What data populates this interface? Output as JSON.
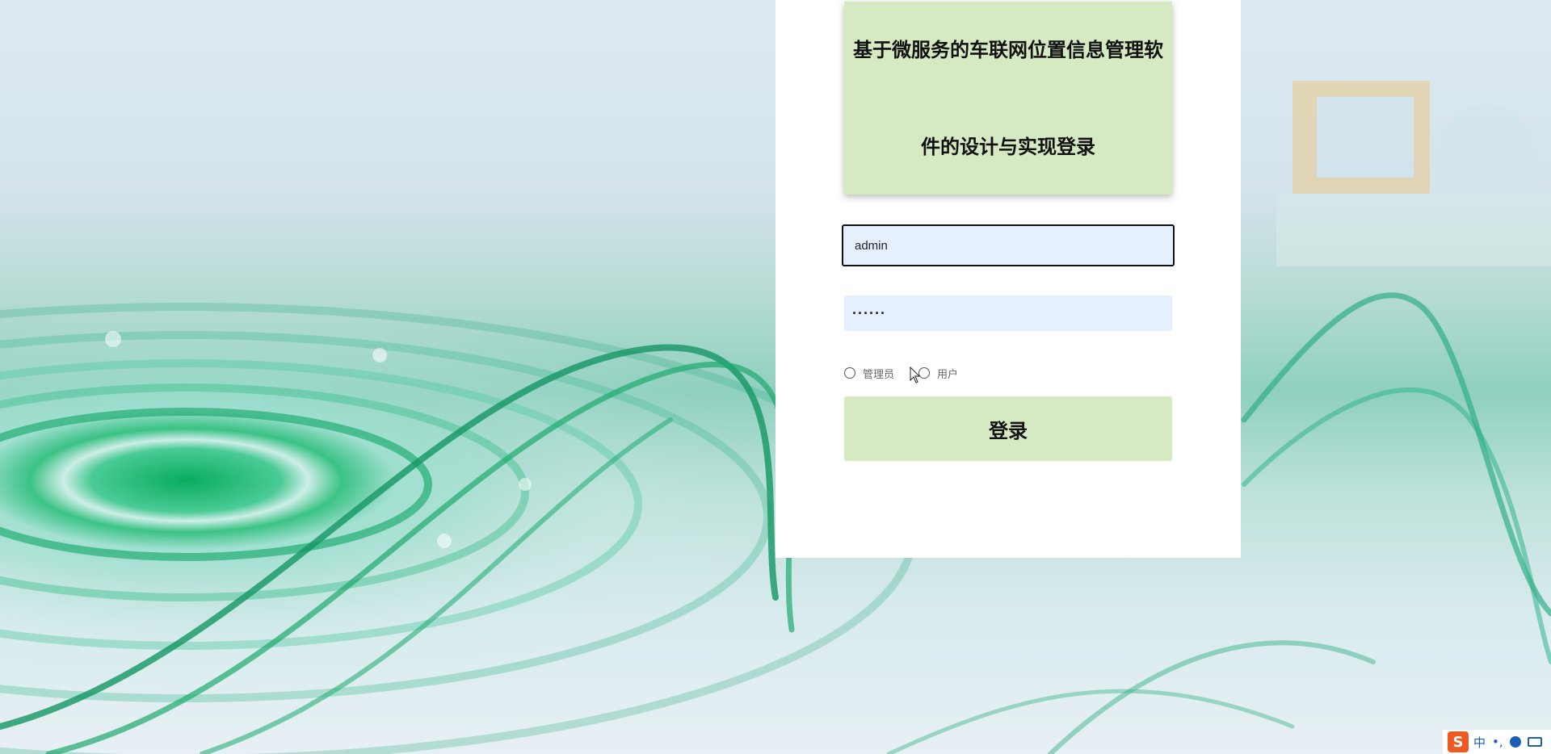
{
  "login": {
    "title": "基于微服务的车联网位置信息管理软件的设计与实现登录",
    "username_value": "admin",
    "password_value": "······",
    "roles": [
      {
        "label": "管理员"
      },
      {
        "label": "用户"
      }
    ],
    "submit_label": "登录"
  },
  "ime_tray": {
    "logo": "S",
    "mode": "中",
    "punct": "•,",
    "icons": [
      "smiley-icon",
      "keyboard-icon"
    ]
  },
  "colors": {
    "title_bg": "#d5e9c3",
    "button_bg": "#d5e9c3",
    "input_bg": "#e6effd",
    "panel_bg": "#ffffff"
  }
}
